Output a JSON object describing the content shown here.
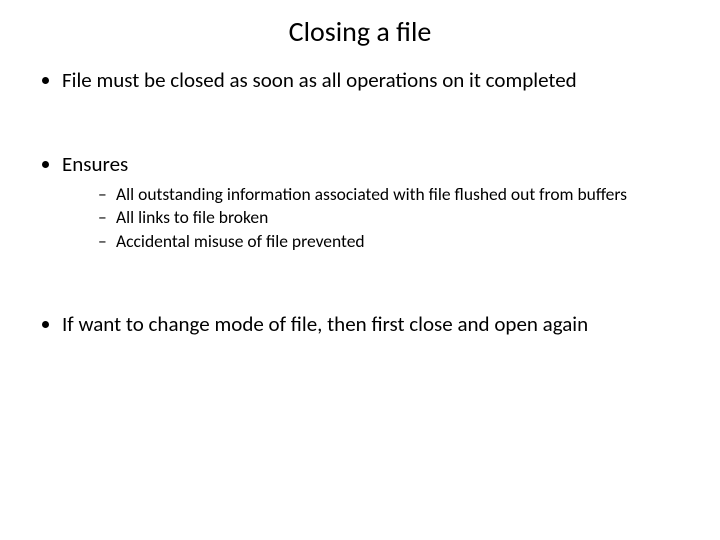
{
  "title": "Closing a file",
  "bullets": {
    "b1": "File must be closed as soon as all operations on it completed",
    "b2": "Ensures",
    "b2_sub": {
      "s1": "All outstanding information associated with file flushed out from buffers",
      "s2": "All links to file broken",
      "s3": "Accidental misuse of file prevented"
    },
    "b3": "If want to change mode of file, then first close and open again"
  }
}
